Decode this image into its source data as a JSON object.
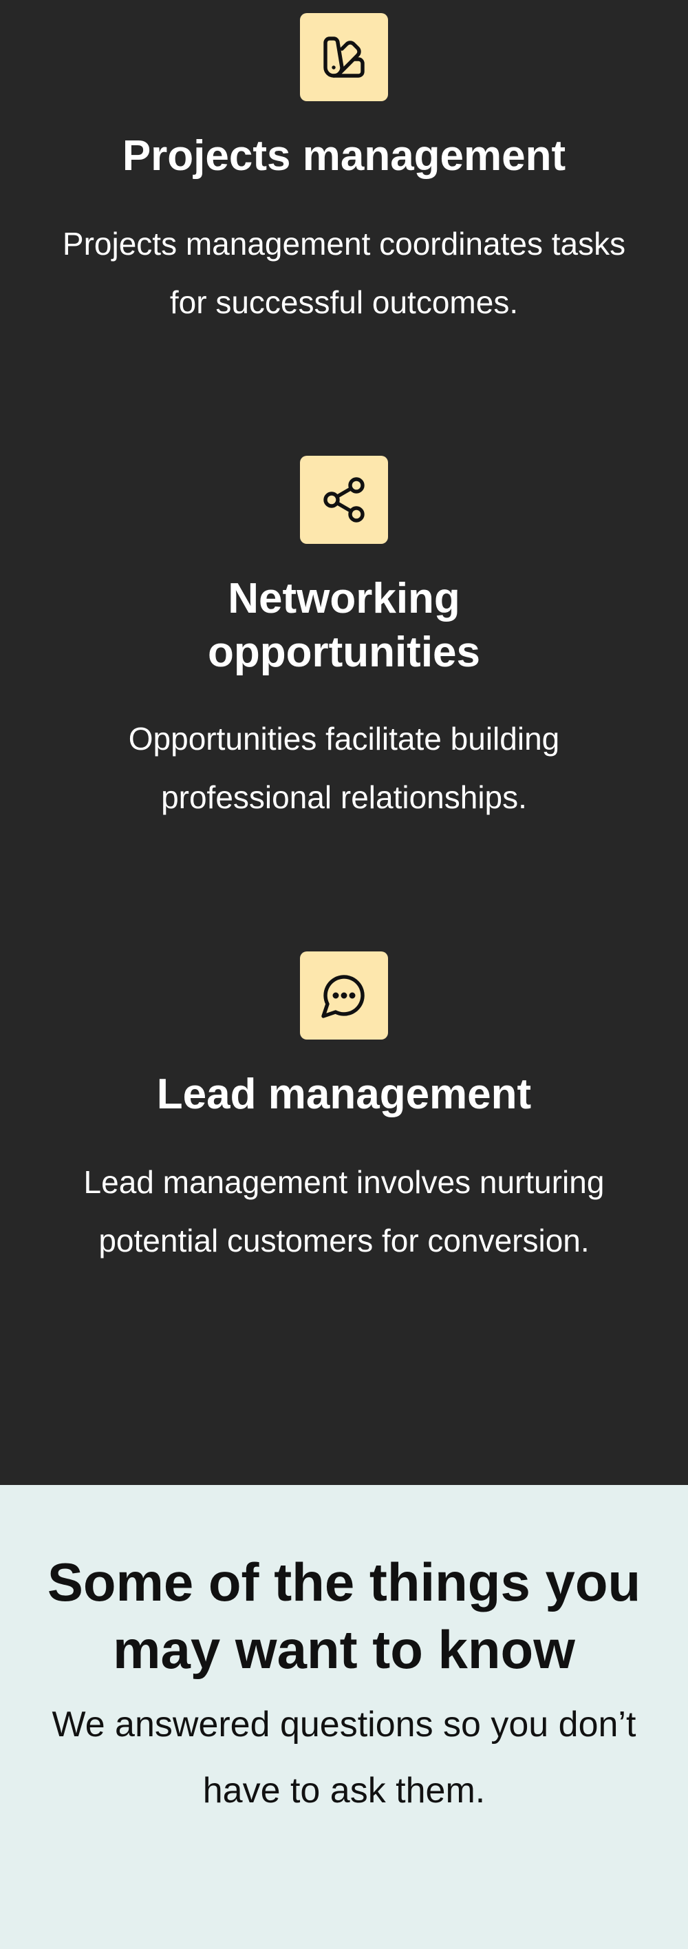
{
  "features": [
    {
      "icon": "swatch-book-icon",
      "title": "Projects management",
      "description": "Projects management coordinates tasks for successful outcomes."
    },
    {
      "icon": "share-icon",
      "title": "Networking opportunities",
      "description": "Opportunities facilitate building professional relationships."
    },
    {
      "icon": "chat-bubble-icon",
      "title": "Lead management",
      "description": "Lead management involves nurturing potential customers for conversion."
    }
  ],
  "faq": {
    "title": "Some of the things you may want to know",
    "subtitle": "We answered questions so you don’t have to ask them."
  },
  "colors": {
    "dark_bg": "#272727",
    "icon_tile": "#fde7ad",
    "light_bg": "#e4f0ef",
    "text_light": "#ffffff",
    "text_dark": "#111111"
  }
}
